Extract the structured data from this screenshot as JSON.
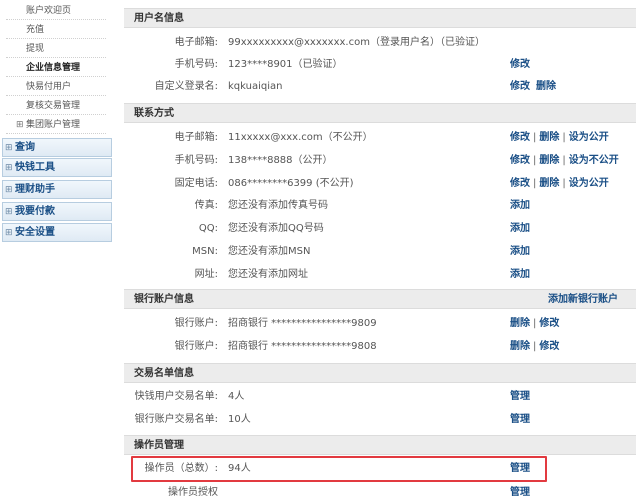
{
  "sidebar": {
    "sub_items": [
      {
        "label": "账户欢迎页",
        "active": false
      },
      {
        "label": "充值",
        "active": false
      },
      {
        "label": "提现",
        "active": false
      },
      {
        "label": "企业信息管理",
        "active": true
      },
      {
        "label": "快易付用户",
        "active": false
      },
      {
        "label": "复核交易管理",
        "active": false
      },
      {
        "label": "集团账户管理",
        "active": false,
        "expander": "⊞"
      }
    ],
    "main_nav": [
      {
        "label": "查询",
        "expander": "⊞"
      },
      {
        "label": "快钱工具",
        "expander": "⊞"
      },
      {
        "label": "理财助手",
        "expander": "⊞"
      },
      {
        "label": "我要付款",
        "expander": "⊞"
      },
      {
        "label": "安全设置",
        "expander": "⊞"
      }
    ]
  },
  "sections": [
    {
      "title": "用户名信息",
      "rows": [
        {
          "label": "电子邮箱:",
          "value": "99xxxxxxxxx@xxxxxxx.com（登录用户名）（已验证）",
          "actions": []
        },
        {
          "label": "手机号码:",
          "value": "123****8901（已验证）",
          "actions": [
            "修改"
          ]
        },
        {
          "label": "自定义登录名:",
          "value": "kqkuaiqian",
          "actions": [
            "修改",
            "删除"
          ],
          "separator": ""
        }
      ]
    },
    {
      "title": "联系方式",
      "rows": [
        {
          "label": "电子邮箱:",
          "value": "11xxxxx@xxx.com（不公开）",
          "actions": [
            "修改",
            "删除",
            "设为公开"
          ],
          "separator": "|"
        },
        {
          "label": "手机号码:",
          "value": "138****8888（公开）",
          "actions": [
            "修改",
            "删除",
            "设为不公开"
          ],
          "separator": "|"
        },
        {
          "label": "固定电话:",
          "value": "086********6399 (不公开)",
          "actions": [
            "修改",
            "删除",
            "设为公开"
          ],
          "separator": "|"
        },
        {
          "label": "传真:",
          "value": "您还没有添加传真号码",
          "actions": [
            "添加"
          ]
        },
        {
          "label": "QQ:",
          "value": "您还没有添加QQ号码",
          "actions": [
            "添加"
          ]
        },
        {
          "label": "MSN:",
          "value": "您还没有添加MSN",
          "actions": [
            "添加"
          ]
        },
        {
          "label": "网址:",
          "value": "您还没有添加网址",
          "actions": [
            "添加"
          ]
        }
      ]
    },
    {
      "title": "银行账户信息",
      "header_link": "添加新银行账户",
      "rows": [
        {
          "label": "银行账户:",
          "value": "招商银行  ****************9809",
          "actions": [
            "删除",
            "修改"
          ],
          "separator": "|"
        },
        {
          "label": "银行账户:",
          "value": "招商银行  ****************9808",
          "actions": [
            "删除",
            "修改"
          ],
          "separator": "|"
        }
      ]
    },
    {
      "title": "交易名单信息",
      "rows": [
        {
          "label": "快钱用户交易名单:",
          "value": "4人",
          "actions": [
            "管理"
          ]
        },
        {
          "label": "银行账户交易名单:",
          "value": "10人",
          "actions": [
            "管理"
          ]
        }
      ]
    },
    {
      "title": "操作员管理",
      "rows": [
        {
          "label": "操作员（总数）:",
          "value": "94人",
          "actions": [
            "管理"
          ]
        },
        {
          "label": "操作员授权",
          "value": "",
          "actions": [
            "管理"
          ]
        }
      ]
    }
  ],
  "colors": {
    "link": "#1a4f86",
    "highlight_border": "#e23a40",
    "section_header_bg": "#ececec"
  }
}
